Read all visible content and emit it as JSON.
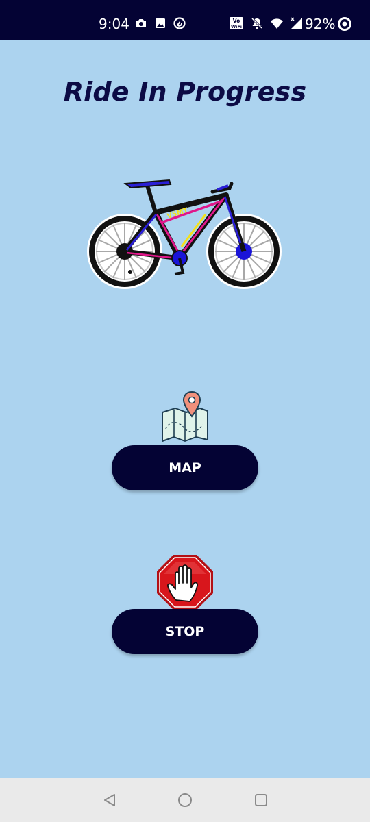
{
  "status_bar": {
    "time": "9:04",
    "battery": "92%",
    "left_icons": [
      "camera-icon",
      "image-icon",
      "sync-icon"
    ],
    "right_icons": [
      "vowifi-icon",
      "notifications-off-icon",
      "wifi-icon",
      "signal-icon"
    ],
    "vowifi_label_top": "Vo",
    "vowifi_label_bottom": "WiFi"
  },
  "page": {
    "title": "Ride In Progress",
    "bike_brand": "V5MT"
  },
  "actions": {
    "map_label": "MAP",
    "stop_label": "STOP"
  },
  "colors": {
    "background": "#acd3ef",
    "status_bar": "#040334",
    "button": "#040334",
    "title": "#0c0b45",
    "stop_sign": "#d8161c",
    "map_pin": "#f0907c"
  },
  "nav_bar": {
    "buttons": [
      "back-icon",
      "home-icon",
      "recents-icon"
    ]
  }
}
